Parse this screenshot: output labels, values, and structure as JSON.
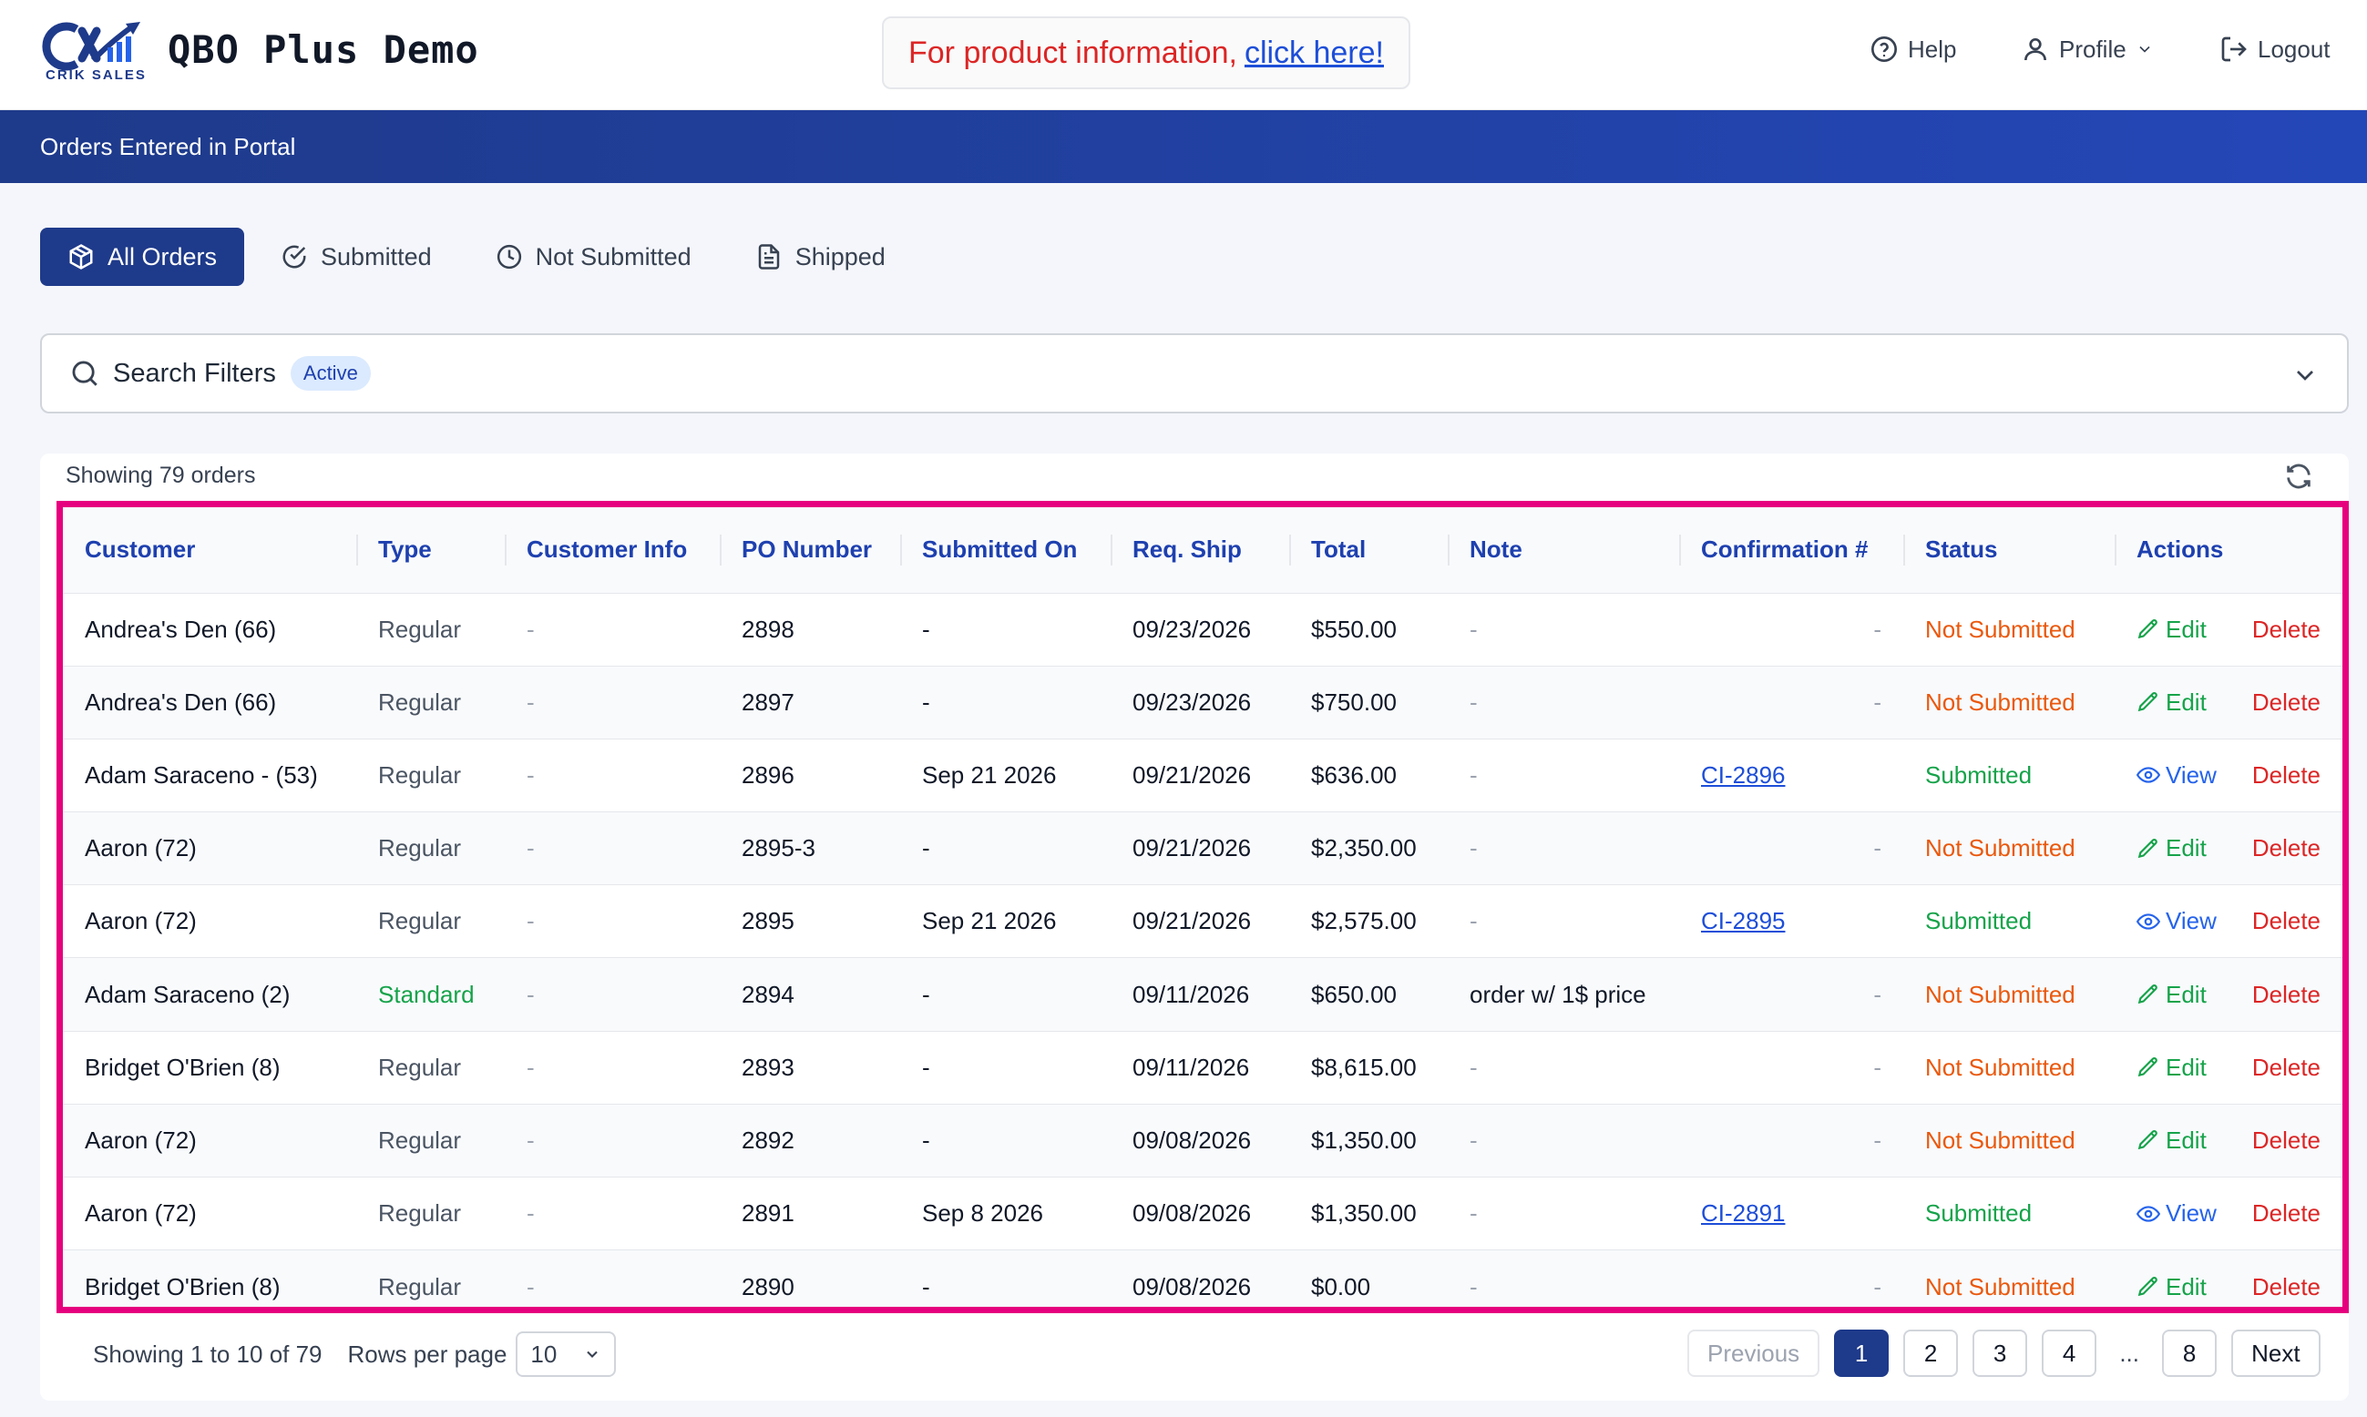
{
  "header": {
    "logo_text": "CRIK SALES",
    "app_title": "QBO Plus Demo",
    "promo_text": "For product information,",
    "promo_link": "click here!",
    "nav": {
      "help": "Help",
      "profile": "Profile",
      "logout": "Logout"
    }
  },
  "page_banner": "Orders Entered in Portal",
  "tabs": [
    {
      "label": "All Orders",
      "icon": "box-icon",
      "active": true
    },
    {
      "label": "Submitted",
      "icon": "check-circle-icon",
      "active": false
    },
    {
      "label": "Not Submitted",
      "icon": "clock-icon",
      "active": false
    },
    {
      "label": "Shipped",
      "icon": "document-icon",
      "active": false
    }
  ],
  "filters": {
    "label": "Search Filters",
    "badge": "Active"
  },
  "summary": "Showing 79 orders",
  "table": {
    "columns": [
      "Customer",
      "Type",
      "Customer Info",
      "PO Number",
      "Submitted On",
      "Req. Ship",
      "Total",
      "Note",
      "Confirmation #",
      "Status",
      "Actions"
    ],
    "rows": [
      {
        "customer": "Andrea's Den (66)",
        "type": "Regular",
        "info": "-",
        "po": "2898",
        "submitted_on": "-",
        "req_ship": "09/23/2026",
        "total": "$550.00",
        "note": "-",
        "confirmation": "-",
        "status": "Not Submitted",
        "action": "Edit",
        "delete": "Delete"
      },
      {
        "customer": "Andrea's Den (66)",
        "type": "Regular",
        "info": "-",
        "po": "2897",
        "submitted_on": "-",
        "req_ship": "09/23/2026",
        "total": "$750.00",
        "note": "-",
        "confirmation": "-",
        "status": "Not Submitted",
        "action": "Edit",
        "delete": "Delete"
      },
      {
        "customer": "Adam Saraceno - (53)",
        "type": "Regular",
        "info": "-",
        "po": "2896",
        "submitted_on": "Sep 21 2026",
        "req_ship": "09/21/2026",
        "total": "$636.00",
        "note": "-",
        "confirmation": "CI-2896",
        "status": "Submitted",
        "action": "View",
        "delete": "Delete"
      },
      {
        "customer": "Aaron (72)",
        "type": "Regular",
        "info": "-",
        "po": "2895-3",
        "submitted_on": "-",
        "req_ship": "09/21/2026",
        "total": "$2,350.00",
        "note": "-",
        "confirmation": "-",
        "status": "Not Submitted",
        "action": "Edit",
        "delete": "Delete"
      },
      {
        "customer": "Aaron (72)",
        "type": "Regular",
        "info": "-",
        "po": "2895",
        "submitted_on": "Sep 21 2026",
        "req_ship": "09/21/2026",
        "total": "$2,575.00",
        "note": "-",
        "confirmation": "CI-2895",
        "status": "Submitted",
        "action": "View",
        "delete": "Delete"
      },
      {
        "customer": "Adam Saraceno (2)",
        "type": "Standard",
        "info": "-",
        "po": "2894",
        "submitted_on": "-",
        "req_ship": "09/11/2026",
        "total": "$650.00",
        "note": "order w/ 1$ price",
        "confirmation": "-",
        "status": "Not Submitted",
        "action": "Edit",
        "delete": "Delete"
      },
      {
        "customer": "Bridget O'Brien (8)",
        "type": "Regular",
        "info": "-",
        "po": "2893",
        "submitted_on": "-",
        "req_ship": "09/11/2026",
        "total": "$8,615.00",
        "note": "-",
        "confirmation": "-",
        "status": "Not Submitted",
        "action": "Edit",
        "delete": "Delete"
      },
      {
        "customer": "Aaron (72)",
        "type": "Regular",
        "info": "-",
        "po": "2892",
        "submitted_on": "-",
        "req_ship": "09/08/2026",
        "total": "$1,350.00",
        "note": "-",
        "confirmation": "-",
        "status": "Not Submitted",
        "action": "Edit",
        "delete": "Delete"
      },
      {
        "customer": "Aaron (72)",
        "type": "Regular",
        "info": "-",
        "po": "2891",
        "submitted_on": "Sep 8 2026",
        "req_ship": "09/08/2026",
        "total": "$1,350.00",
        "note": "-",
        "confirmation": "CI-2891",
        "status": "Submitted",
        "action": "View",
        "delete": "Delete"
      },
      {
        "customer": "Bridget O'Brien (8)",
        "type": "Regular",
        "info": "-",
        "po": "2890",
        "submitted_on": "-",
        "req_ship": "09/08/2026",
        "total": "$0.00",
        "note": "-",
        "confirmation": "-",
        "status": "Not Submitted",
        "action": "Edit",
        "delete": "Delete"
      }
    ]
  },
  "pagination": {
    "showing": "Showing 1 to 10 of 79",
    "rows_label": "Rows per page",
    "rows_value": "10",
    "previous": "Previous",
    "pages": [
      "1",
      "2",
      "3",
      "4"
    ],
    "ellipsis": "...",
    "last_page": "8",
    "next": "Next",
    "current": "1"
  },
  "colors": {
    "brand": "#1e3a8a",
    "highlight_border": "#e6007e",
    "not_submitted": "#ea580c",
    "submitted": "#16a34a",
    "delete": "#dc2626"
  }
}
